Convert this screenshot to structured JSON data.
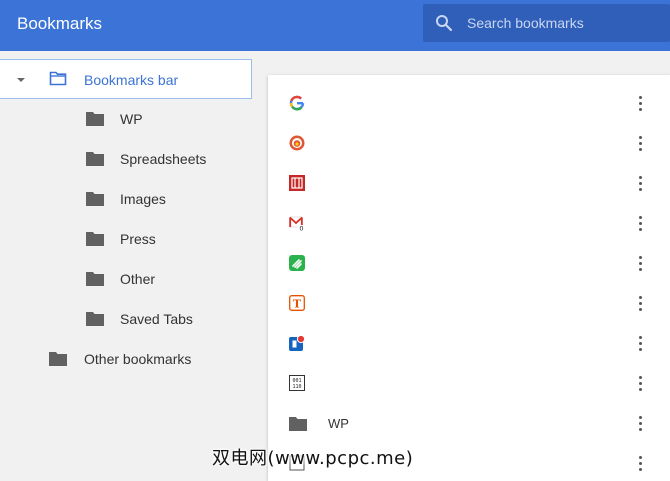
{
  "header": {
    "title": "Bookmarks",
    "search_placeholder": "Search bookmarks"
  },
  "sidebar": {
    "root": {
      "label": "Bookmarks bar",
      "expanded": true,
      "selected": true
    },
    "children": [
      {
        "label": "WP"
      },
      {
        "label": "Spreadsheets"
      },
      {
        "label": "Images"
      },
      {
        "label": "Press"
      },
      {
        "label": "Other"
      },
      {
        "label": "Saved Tabs"
      }
    ],
    "other": {
      "label": "Other bookmarks"
    }
  },
  "list": {
    "items": [
      {
        "icon": "google-favicon-icon",
        "title": ""
      },
      {
        "icon": "duckduckgo-favicon-icon",
        "title": ""
      },
      {
        "icon": "red-site-favicon-icon",
        "title": ""
      },
      {
        "icon": "gmail-favicon-icon",
        "title": ""
      },
      {
        "icon": "feedly-favicon-icon",
        "title": ""
      },
      {
        "icon": "t-letter-favicon-icon",
        "title": ""
      },
      {
        "icon": "pushbullet-favicon-icon",
        "title": ""
      },
      {
        "icon": "binary-favicon-icon",
        "title": ""
      },
      {
        "icon": "folder-icon",
        "title": "WP"
      },
      {
        "icon": "partial-favicon-icon",
        "title": ""
      }
    ]
  },
  "watermark": "双电网(www.pcpc.me)",
  "colors": {
    "header_bg": "#3b73d6",
    "search_bg": "#2f5fb9",
    "selected_text": "#3b73d6",
    "folder_grey": "#616161"
  }
}
